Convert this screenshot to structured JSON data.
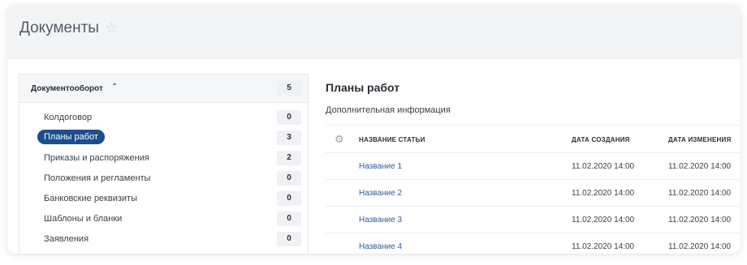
{
  "header": {
    "title": "Документы",
    "star_icon": "star-icon"
  },
  "sidebar": {
    "group": {
      "title": "Документооборот",
      "count": "5",
      "chevron_icon": "chevron-up-icon"
    },
    "items": [
      {
        "label": "Колдоговор",
        "count": "0",
        "active": false
      },
      {
        "label": "Планы работ",
        "count": "3",
        "active": true
      },
      {
        "label": "Приказы и распоряжения",
        "count": "2",
        "active": false
      },
      {
        "label": "Положения и регламенты",
        "count": "0",
        "active": false
      },
      {
        "label": "Банковские реквизиты",
        "count": "0",
        "active": false
      },
      {
        "label": "Шаблоны и бланки",
        "count": "0",
        "active": false
      },
      {
        "label": "Заявления",
        "count": "0",
        "active": false
      }
    ]
  },
  "main": {
    "title": "Планы работ",
    "subtitle": "Дополнительная информация",
    "table": {
      "settings_icon": "gear-icon",
      "columns": [
        "НАЗВАНИЕ СТАТЬИ",
        "ДАТА СОЗДАНИЯ",
        "ДАТА ИЗМЕНЕНИЯ"
      ],
      "rows": [
        {
          "name": "Название 1",
          "created": "11.02.2020 14:00",
          "modified": "11.02.2020 14:00"
        },
        {
          "name": "Название 2",
          "created": "11.02.2020 14:00",
          "modified": "11.02.2020 14:00"
        },
        {
          "name": "Название 3",
          "created": "11.02.2020 14:00",
          "modified": "11.02.2020 14:00"
        },
        {
          "name": "Название 4",
          "created": "11.02.2020 14:00",
          "modified": "11.02.2020 14:00"
        }
      ]
    }
  },
  "colors": {
    "accent": "#1c4e8c",
    "link": "#2f5c97",
    "header_bg": "#f3f4f6"
  }
}
